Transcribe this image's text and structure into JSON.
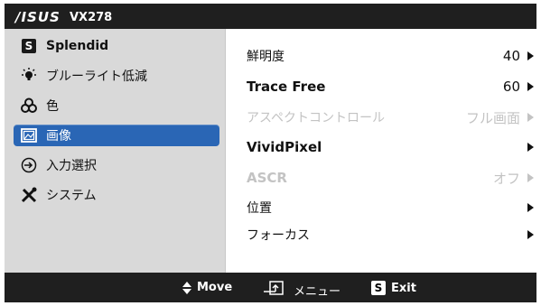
{
  "header": {
    "brand": "/ISUS",
    "model": "VX278"
  },
  "sidebar": {
    "items": [
      {
        "label": "Splendid",
        "icon": "s-box-icon"
      },
      {
        "label": "ブルーライト低減",
        "icon": "bulb-icon"
      },
      {
        "label": "色",
        "icon": "color-circles-icon"
      },
      {
        "label": "画像",
        "icon": "picture-icon"
      },
      {
        "label": "入力選択",
        "icon": "input-icon"
      },
      {
        "label": "システム",
        "icon": "tools-icon"
      }
    ],
    "active_index": 3
  },
  "content": {
    "rows": [
      {
        "label": "鮮明度",
        "value": "40",
        "bold": false,
        "disabled": false
      },
      {
        "label": "Trace Free",
        "value": "60",
        "bold": true,
        "disabled": false
      },
      {
        "label": "アスペクトコントロール",
        "value": "フル画面",
        "bold": false,
        "disabled": true
      },
      {
        "label": "VividPixel",
        "value": "",
        "bold": true,
        "disabled": false
      },
      {
        "label": "ASCR",
        "value": "オフ",
        "bold": true,
        "disabled": true
      },
      {
        "label": "位置",
        "value": "",
        "bold": false,
        "disabled": false
      },
      {
        "label": "フォーカス",
        "value": "",
        "bold": false,
        "disabled": false
      }
    ]
  },
  "footer": {
    "move": "Move",
    "menu": "メニュー",
    "exit_key": "S",
    "exit": "Exit"
  },
  "colors": {
    "bar": "#1f1f1f",
    "sidebar": "#d9d9d9",
    "active": "#2a66b5",
    "disabled": "#c3c3c3"
  }
}
